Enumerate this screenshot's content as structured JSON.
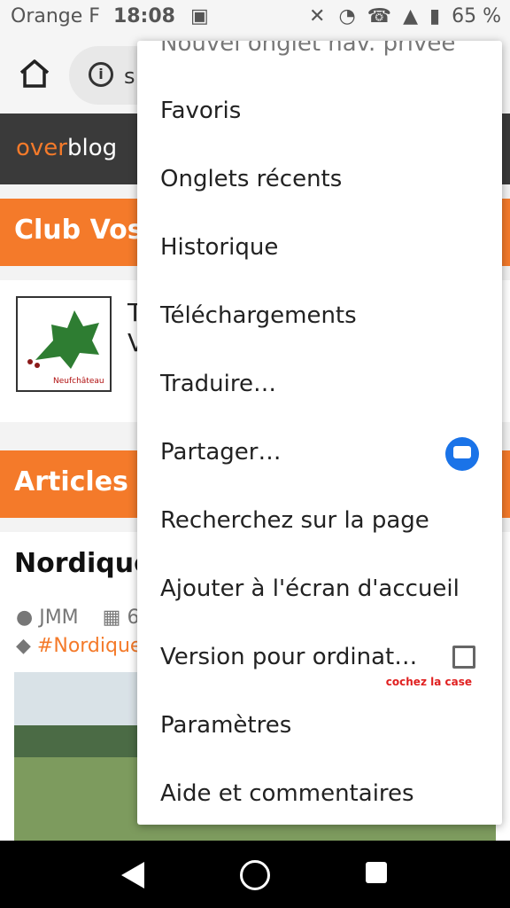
{
  "status": {
    "carrier": "Orange F",
    "time": "18:08",
    "battery": "65 %"
  },
  "browser": {
    "url_partial": "s"
  },
  "site": {
    "logo_over": "over",
    "logo_blog": "blog",
    "club_title": "Club Vosg",
    "card_line1": "T",
    "card_line2": "V",
    "logo_caption": "Neufchâteau",
    "articles_title": "Articles re",
    "article_title": "Nordique",
    "author": "JMM",
    "date_partial": "6",
    "tag": "#Nordique"
  },
  "menu": {
    "items": [
      "Nouvel onglet nav. privée",
      "Favoris",
      "Onglets récents",
      "Historique",
      "Téléchargements",
      "Traduire…",
      "Partager…",
      "Recherchez sur la page",
      "Ajouter à l'écran d'accueil",
      "Version pour ordinat…",
      "Paramètres",
      "Aide et commentaires"
    ],
    "annotation": "cochez la case"
  },
  "colors": {
    "accent": "#f47a2a",
    "header_dark": "#3a3a3a",
    "share_blue": "#1a73e8",
    "annotation_red": "#e02020"
  }
}
